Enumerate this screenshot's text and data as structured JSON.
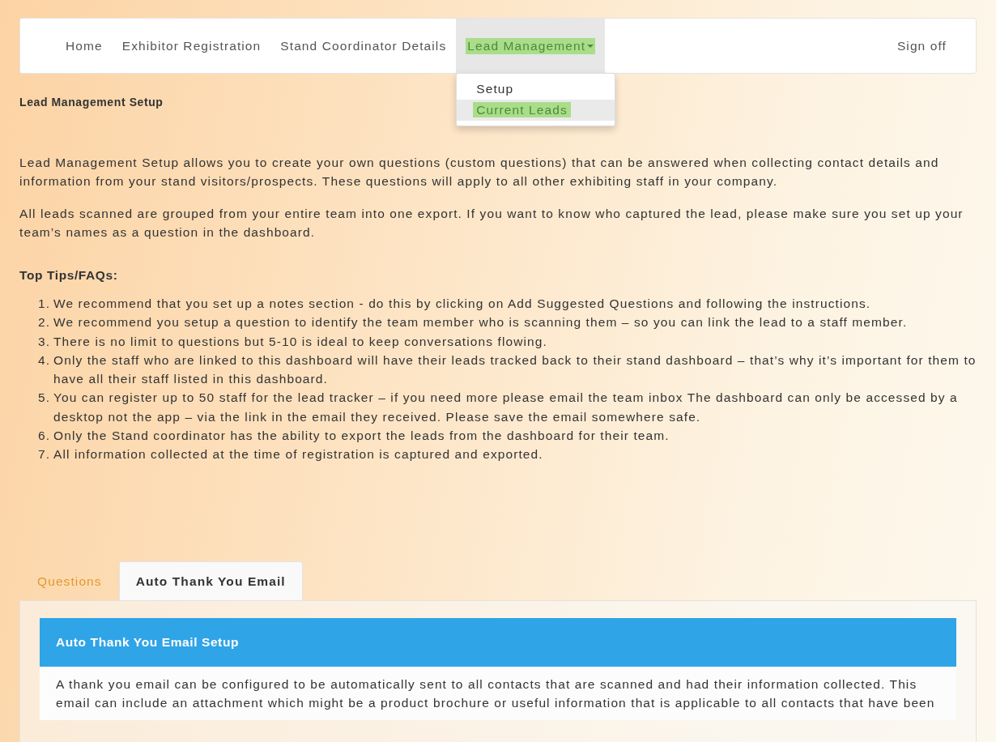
{
  "nav": {
    "items": [
      {
        "label": "Home",
        "selected": false,
        "highlighted": false,
        "dropdown": false
      },
      {
        "label": "Exhibitor Registration",
        "selected": false,
        "highlighted": false,
        "dropdown": false
      },
      {
        "label": "Stand Coordinator Details",
        "selected": false,
        "highlighted": false,
        "dropdown": false
      },
      {
        "label": "Lead Management",
        "selected": true,
        "highlighted": true,
        "dropdown": true
      }
    ],
    "right_item": {
      "label": "Sign off"
    },
    "menu": {
      "items": [
        {
          "label": "Setup",
          "selected": false,
          "highlighted": false
        },
        {
          "label": "Current Leads",
          "selected": true,
          "highlighted": true
        }
      ]
    }
  },
  "page_title": "Lead Management Setup",
  "paragraphs": [
    "Lead Management Setup allows you to create your own questions (custom questions) that can be answered when collecting contact details and information from your stand visitors/prospects. These questions will apply to all other exhibiting staff in your company.",
    "All leads scanned are grouped from your entire team into one export. If you want to know who captured the lead, please make sure you set up your team’s names as a question in the dashboard."
  ],
  "tips": {
    "title": "Top Tips/FAQs:",
    "items": [
      {
        "number": "1.",
        "text": "We recommend that you set up a notes section - do this by clicking on Add Suggested Questions and following the instructions."
      },
      {
        "number": "2.",
        "text": "We recommend you setup a question to identify the team member who is scanning them – so you can link the lead to a staff member."
      },
      {
        "number": "3.",
        "text": "There is no limit to questions but 5-10 is ideal to keep conversations flowing."
      },
      {
        "number": "4.",
        "text": "Only the staff who are linked to this dashboard will have their leads tracked back to their stand dashboard – that’s why it’s important for them to have all their staff listed in this dashboard."
      },
      {
        "number": "5.",
        "text": "You can register up to 50 staff for the lead tracker – if you need more please email the team inbox The dashboard can only be accessed by a desktop not the app – via the link in the email they received. Please save the email somewhere safe."
      },
      {
        "number": "6.",
        "text": "Only the Stand coordinator has the ability to export the leads from the dashboard for their team."
      },
      {
        "number": "7.",
        "text": "All information collected at the time of registration is captured and exported."
      }
    ]
  },
  "tabs": [
    {
      "label": "Questions",
      "selected": false
    },
    {
      "label": "Auto Thank You Email",
      "selected": true
    }
  ],
  "panel": {
    "title": "Auto Thank You Email Setup",
    "body": "A thank you email can be configured to be automatically sent to all contacts that are scanned and had their information collected. This email can include an attachment which might be a product brochure or useful information that is applicable to all contacts that have been"
  }
}
